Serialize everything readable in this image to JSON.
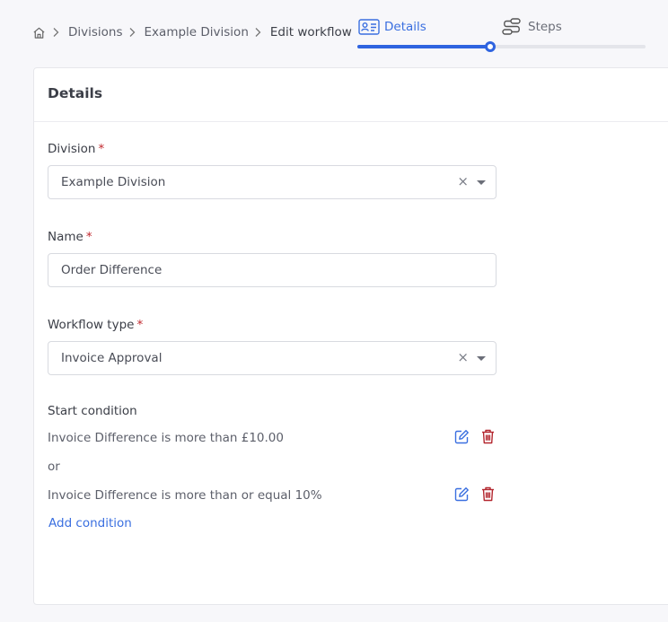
{
  "breadcrumb": {
    "home_icon": "home-icon",
    "items": [
      "Divisions",
      "Example Division",
      "Edit workflow"
    ]
  },
  "stepper": {
    "steps": [
      {
        "label": "Details",
        "icon": "id-card-icon",
        "active": true
      },
      {
        "label": "Steps",
        "icon": "route-icon",
        "active": false
      }
    ],
    "progress_percent": 46
  },
  "card": {
    "title": "Details"
  },
  "form": {
    "division": {
      "label": "Division",
      "required_mark": "*",
      "value": "Example Division"
    },
    "name": {
      "label": "Name",
      "required_mark": "*",
      "value": "Order Difference"
    },
    "workflow_type": {
      "label": "Workflow type",
      "required_mark": "*",
      "value": "Invoice Approval"
    },
    "start_condition": {
      "label": "Start condition",
      "conditions": [
        "Invoice Difference is more than £10.00",
        "Invoice Difference is more than or equal 10%"
      ],
      "joiner": "or",
      "add_label": "Add condition"
    }
  },
  "colors": {
    "accent": "#2f64e0",
    "link": "#3a6fe0",
    "required": "#c0272d",
    "delete": "#b3262e",
    "background": "#f7f7fa"
  }
}
